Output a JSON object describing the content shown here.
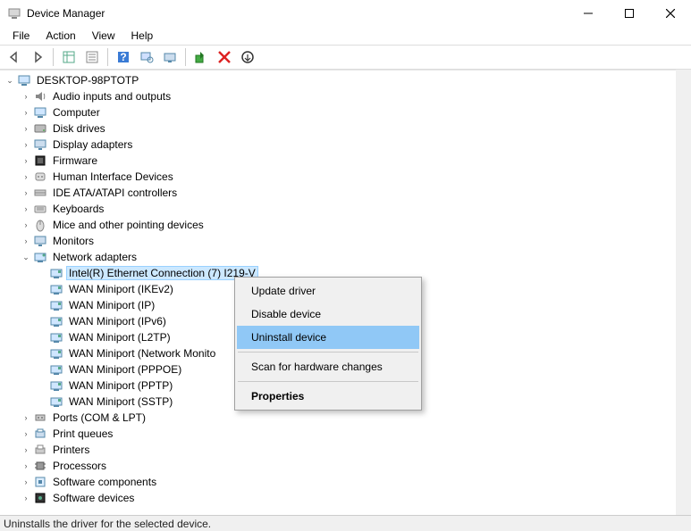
{
  "window": {
    "title": "Device Manager"
  },
  "menu": {
    "file": "File",
    "action": "Action",
    "view": "View",
    "help": "Help"
  },
  "tree": {
    "root": "DESKTOP-98PTOTP",
    "categories": [
      {
        "label": "Audio inputs and outputs",
        "icon": "audio"
      },
      {
        "label": "Computer",
        "icon": "computer"
      },
      {
        "label": "Disk drives",
        "icon": "disk"
      },
      {
        "label": "Display adapters",
        "icon": "display"
      },
      {
        "label": "Firmware",
        "icon": "firmware"
      },
      {
        "label": "Human Interface Devices",
        "icon": "hid"
      },
      {
        "label": "IDE ATA/ATAPI controllers",
        "icon": "ide"
      },
      {
        "label": "Keyboards",
        "icon": "keyboard"
      },
      {
        "label": "Mice and other pointing devices",
        "icon": "mouse"
      },
      {
        "label": "Monitors",
        "icon": "monitor"
      },
      {
        "label": "Network adapters",
        "icon": "network",
        "expanded": true
      }
    ],
    "netadapters": [
      {
        "label": "Intel(R) Ethernet Connection (7) I219-V",
        "selected": true
      },
      {
        "label": "WAN Miniport (IKEv2)"
      },
      {
        "label": "WAN Miniport (IP)"
      },
      {
        "label": "WAN Miniport (IPv6)"
      },
      {
        "label": "WAN Miniport (L2TP)"
      },
      {
        "label": "WAN Miniport (Network Monito"
      },
      {
        "label": "WAN Miniport (PPPOE)"
      },
      {
        "label": "WAN Miniport (PPTP)"
      },
      {
        "label": "WAN Miniport (SSTP)"
      }
    ],
    "categories2": [
      {
        "label": "Ports (COM & LPT)",
        "icon": "ports"
      },
      {
        "label": "Print queues",
        "icon": "printqueue"
      },
      {
        "label": "Printers",
        "icon": "printer"
      },
      {
        "label": "Processors",
        "icon": "cpu"
      },
      {
        "label": "Software components",
        "icon": "swcomp"
      },
      {
        "label": "Software devices",
        "icon": "swdev"
      }
    ]
  },
  "contextmenu": {
    "update": "Update driver",
    "disable": "Disable device",
    "uninstall": "Uninstall device",
    "scan": "Scan for hardware changes",
    "properties": "Properties"
  },
  "statusbar": {
    "text": "Uninstalls the driver for the selected device."
  }
}
